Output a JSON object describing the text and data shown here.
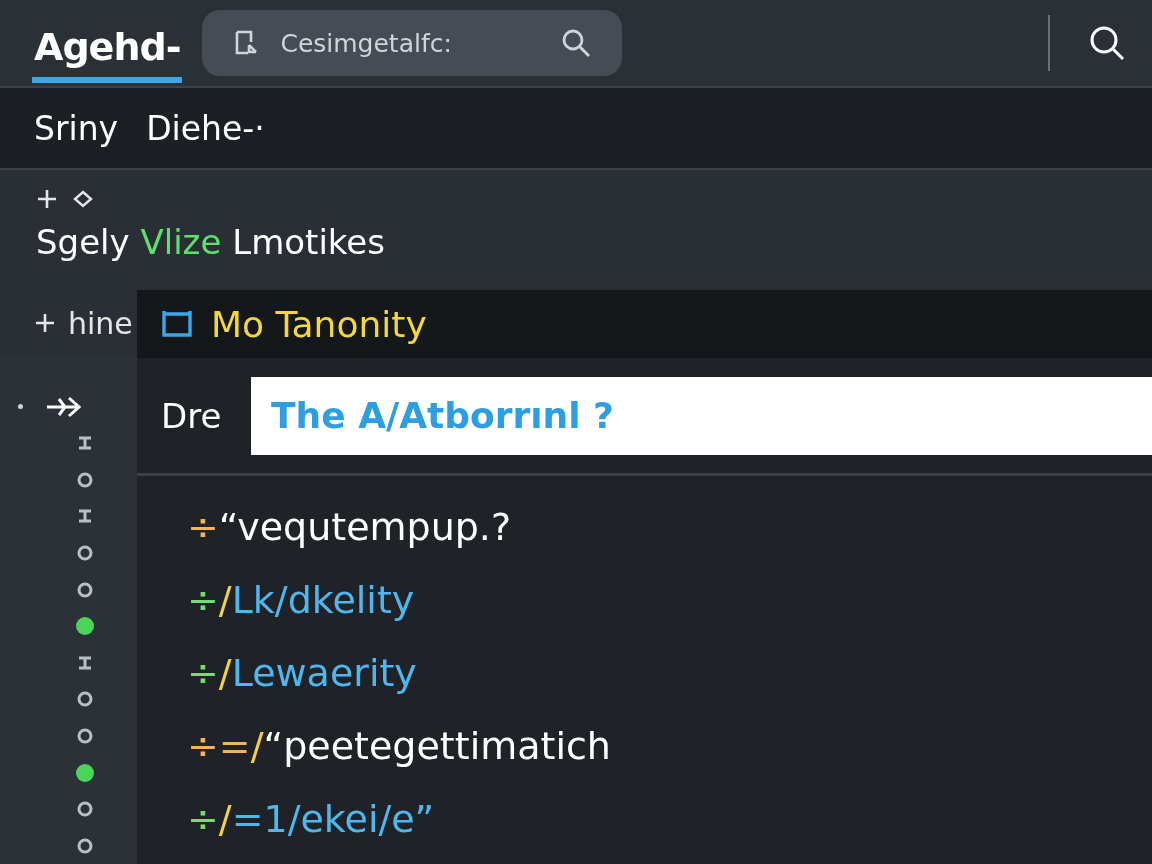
{
  "top_bar": {
    "tabs": [
      {
        "label": "Agehd-",
        "selected": true
      }
    ],
    "search": {
      "placeholder": "Cesimgetalfc:"
    }
  },
  "sub_bar": {
    "items": [
      "Sriny",
      "Diehe-·"
    ]
  },
  "section": {
    "title_parts": [
      {
        "text": "Sgely",
        "highlight": false
      },
      {
        "text": "Vlize",
        "highlight": true
      },
      {
        "text": "Lmotikes",
        "highlight": false
      }
    ]
  },
  "rail": {
    "header": "hine",
    "markers": [
      {
        "kind": "tick"
      },
      {
        "kind": "ring"
      },
      {
        "kind": "tick"
      },
      {
        "kind": "ring"
      },
      {
        "kind": "ring"
      },
      {
        "kind": "dot"
      },
      {
        "kind": "tick"
      },
      {
        "kind": "ring"
      },
      {
        "kind": "ring"
      },
      {
        "kind": "dot"
      },
      {
        "kind": "ring"
      },
      {
        "kind": "ring"
      }
    ]
  },
  "panel": {
    "title": "Mo Tanonity",
    "field": {
      "label": "Dre",
      "value": "The A/Atborrınl ?"
    },
    "lines": [
      {
        "tokens": [
          {
            "text": "÷",
            "color": "#f2b35b"
          },
          {
            "text": "“vequtempup.?",
            "color": "#ffffff"
          }
        ]
      },
      {
        "tokens": [
          {
            "text": "÷",
            "color": "#6ee07a"
          },
          {
            "text": "/",
            "color": "#f2d24b"
          },
          {
            "text": "Lk/dkelity",
            "color": "#4fb6ef"
          }
        ]
      },
      {
        "tokens": [
          {
            "text": "÷",
            "color": "#6ee07a"
          },
          {
            "text": "/",
            "color": "#f2d24b"
          },
          {
            "text": "Lewaerity",
            "color": "#4fb6ef"
          }
        ]
      },
      {
        "tokens": [
          {
            "text": "÷=",
            "color": "#f2b35b"
          },
          {
            "text": "/",
            "color": "#f2d24b"
          },
          {
            "text": "“peetegettimatich",
            "color": "#ffffff"
          }
        ]
      },
      {
        "tokens": [
          {
            "text": "÷",
            "color": "#6ee07a"
          },
          {
            "text": "/",
            "color": "#f2d24b"
          },
          {
            "text": "=1/ekei/e”",
            "color": "#4fb6ef"
          }
        ]
      }
    ]
  }
}
